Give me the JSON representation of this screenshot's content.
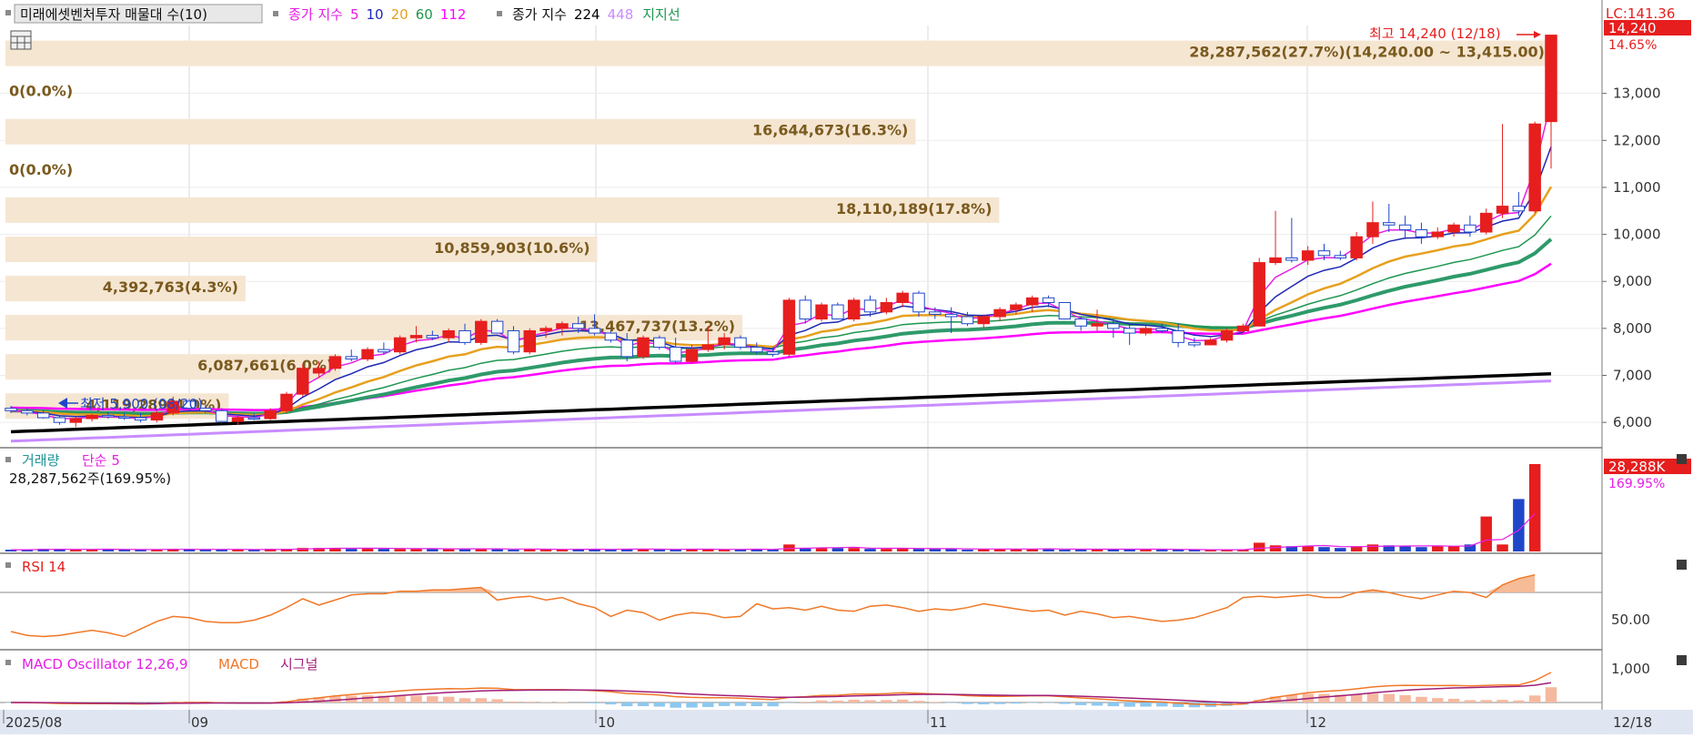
{
  "legend": {
    "panel_title": "미래에셋벤처투자 매물대 수(10)",
    "ma_prefix": "종가 지수",
    "ma_items": [
      {
        "label": "5",
        "color": "#e61ee6"
      },
      {
        "label": "10",
        "color": "#1e28b4"
      },
      {
        "label": "20",
        "color": "#e6a01e"
      },
      {
        "label": "60",
        "color": "#1e9650"
      },
      {
        "label": "112",
        "color": "#ff00ff"
      }
    ],
    "ma2_prefix": "종가 지수",
    "ma2_items": [
      {
        "label": "224",
        "color": "#000000"
      },
      {
        "label": "448",
        "color": "#c88cff"
      }
    ],
    "support_label": "지지선",
    "support_color": "#1e9650"
  },
  "price_panel": {
    "lc_label": "LC:141.36",
    "last_price": "14,240",
    "change_pct": "14.65%",
    "high_label": "최고 14,240 (12/18)",
    "low_label": "최저 5,900 (08/20)",
    "y_ticks": [
      "13,000",
      "12,000",
      "11,000",
      "10,000",
      "9,000",
      "8,000",
      "7,000",
      "6,000"
    ]
  },
  "volume_profile": [
    {
      "label": "28,287,562(27.7%)(14,240.00 ~ 13,415.00)",
      "pct": 27.7
    },
    {
      "label": "0(0.0%)",
      "pct": 0
    },
    {
      "label": "16,644,673(16.3%)",
      "pct": 16.3
    },
    {
      "label": "0(0.0%)",
      "pct": 0
    },
    {
      "label": "18,110,189(17.8%)",
      "pct": 17.8
    },
    {
      "label": "10,859,903(10.6%)",
      "pct": 10.6
    },
    {
      "label": "4,392,763(4.3%)",
      "pct": 4.3
    },
    {
      "label": "13,467,737(13.2%)",
      "pct": 13.2
    },
    {
      "label": "6,087,661(6.0%)",
      "pct": 6.0
    },
    {
      "label": "4,119,289(4.0%)",
      "pct": 4.0
    }
  ],
  "volume_panel": {
    "title": "거래량",
    "ma_label": "단순 5",
    "value_text": "28,287,562주(169.95%)",
    "badge": "28,288K",
    "badge_pct": "169.95%"
  },
  "rsi_panel": {
    "title": "RSI 14",
    "level_label": "50.00"
  },
  "macd_panel": {
    "title": "MACD Oscillator 12,26,9",
    "macd_label": "MACD",
    "signal_label": "시그널",
    "level_label": "1,000"
  },
  "x_axis": {
    "labels": [
      "2025/08",
      "09",
      "10",
      "11",
      "12"
    ],
    "cursor_label": "12/18"
  },
  "colors": {
    "up": "#e61e1e",
    "down": "#1e46c8",
    "rsi": "#f07828",
    "profile_bar": "#f5e6d2",
    "profile_text": "#7a5a1e",
    "macd": "#f07828",
    "signal": "#a01e78",
    "osc_pos": "#f5b9a0",
    "osc_neg": "#8cc8f0"
  },
  "chart_data": {
    "type": "candlestick",
    "x_range": [
      "2025/08",
      "12/18"
    ],
    "ylim": [
      5500,
      14600
    ],
    "candles": [
      [
        6300,
        6350,
        6200,
        6250
      ],
      [
        6250,
        6300,
        6150,
        6200
      ],
      [
        6200,
        6260,
        6080,
        6100
      ],
      [
        6100,
        6150,
        5950,
        6000
      ],
      [
        6000,
        6120,
        5900,
        6080
      ],
      [
        6080,
        6180,
        6020,
        6150
      ],
      [
        6150,
        6220,
        6080,
        6120
      ],
      [
        6120,
        6200,
        6050,
        6100
      ],
      [
        6100,
        6200,
        6000,
        6050
      ],
      [
        6050,
        6250,
        6000,
        6200
      ],
      [
        6200,
        6550,
        6150,
        6450
      ],
      [
        6450,
        6500,
        6250,
        6300
      ],
      [
        6300,
        6380,
        6200,
        6250
      ],
      [
        6250,
        6300,
        5980,
        6020
      ],
      [
        6020,
        6150,
        5950,
        6100
      ],
      [
        6100,
        6180,
        6050,
        6080
      ],
      [
        6080,
        6300,
        6050,
        6250
      ],
      [
        6250,
        6650,
        6200,
        6600
      ],
      [
        6600,
        7250,
        6550,
        7150
      ],
      [
        7050,
        7300,
        6950,
        7150
      ],
      [
        7150,
        7450,
        7100,
        7400
      ],
      [
        7400,
        7550,
        7300,
        7350
      ],
      [
        7350,
        7600,
        7300,
        7550
      ],
      [
        7550,
        7700,
        7450,
        7500
      ],
      [
        7500,
        7850,
        7450,
        7800
      ],
      [
        7800,
        8050,
        7700,
        7850
      ],
      [
        7850,
        7950,
        7750,
        7800
      ],
      [
        7800,
        8000,
        7700,
        7950
      ],
      [
        7950,
        8100,
        7650,
        7700
      ],
      [
        7700,
        8200,
        7650,
        8150
      ],
      [
        8150,
        8200,
        7900,
        7900
      ],
      [
        7950,
        8050,
        7450,
        7500
      ],
      [
        7500,
        8000,
        7450,
        7950
      ],
      [
        7950,
        8050,
        7800,
        8000
      ],
      [
        8000,
        8150,
        7850,
        8100
      ],
      [
        8100,
        8250,
        7900,
        8000
      ],
      [
        8000,
        8300,
        7850,
        7900
      ],
      [
        7900,
        7950,
        7700,
        7750
      ],
      [
        7750,
        7900,
        7300,
        7400
      ],
      [
        7400,
        7850,
        7350,
        7800
      ],
      [
        7800,
        7850,
        7550,
        7600
      ],
      [
        7600,
        7800,
        7250,
        7300
      ],
      [
        7300,
        7650,
        7250,
        7550
      ],
      [
        7550,
        8050,
        7500,
        7650
      ],
      [
        7650,
        7900,
        7550,
        7800
      ],
      [
        7800,
        7850,
        7550,
        7600
      ],
      [
        7600,
        7700,
        7450,
        7500
      ],
      [
        7500,
        7600,
        7400,
        7450
      ],
      [
        7450,
        8650,
        7400,
        8600
      ],
      [
        8600,
        8700,
        8100,
        8200
      ],
      [
        8200,
        8550,
        8150,
        8500
      ],
      [
        8500,
        8550,
        8250,
        8200
      ],
      [
        8200,
        8650,
        8150,
        8600
      ],
      [
        8600,
        8700,
        8250,
        8350
      ],
      [
        8350,
        8650,
        8300,
        8550
      ],
      [
        8550,
        8800,
        8450,
        8750
      ],
      [
        8750,
        8800,
        8250,
        8350
      ],
      [
        8350,
        8450,
        8200,
        8300
      ],
      [
        8300,
        8450,
        7900,
        8250
      ],
      [
        8250,
        8350,
        8050,
        8100
      ],
      [
        8100,
        8300,
        8000,
        8250
      ],
      [
        8250,
        8450,
        8150,
        8400
      ],
      [
        8400,
        8550,
        8300,
        8500
      ],
      [
        8500,
        8700,
        8350,
        8650
      ],
      [
        8650,
        8700,
        8450,
        8550
      ],
      [
        8550,
        8550,
        8250,
        8200
      ],
      [
        8200,
        8250,
        7950,
        8050
      ],
      [
        8050,
        8400,
        7950,
        8100
      ],
      [
        8100,
        8200,
        7800,
        8000
      ],
      [
        8000,
        8100,
        7650,
        7900
      ],
      [
        7900,
        8050,
        7850,
        8000
      ],
      [
        8000,
        8100,
        7900,
        7950
      ],
      [
        7950,
        8100,
        7600,
        7700
      ],
      [
        7700,
        7800,
        7600,
        7650
      ],
      [
        7650,
        7800,
        7650,
        7750
      ],
      [
        7750,
        8000,
        7700,
        7950
      ],
      [
        7950,
        8100,
        7900,
        8050
      ],
      [
        8050,
        9500,
        8050,
        9400
      ],
      [
        9400,
        10500,
        9350,
        9500
      ],
      [
        9500,
        10350,
        9400,
        9450
      ],
      [
        9450,
        9750,
        9350,
        9650
      ],
      [
        9650,
        9800,
        9450,
        9550
      ],
      [
        9550,
        9650,
        9450,
        9500
      ],
      [
        9500,
        10050,
        9450,
        9950
      ],
      [
        9950,
        10700,
        9800,
        10250
      ],
      [
        10250,
        10650,
        10050,
        10200
      ],
      [
        10200,
        10400,
        9900,
        10100
      ],
      [
        10100,
        10250,
        9800,
        9950
      ],
      [
        9950,
        10150,
        9900,
        10050
      ],
      [
        10050,
        10250,
        9950,
        10200
      ],
      [
        10200,
        10400,
        9950,
        10050
      ],
      [
        10050,
        10550,
        10000,
        10450
      ],
      [
        10450,
        12350,
        10350,
        10600
      ],
      [
        10600,
        10900,
        10400,
        10500
      ],
      [
        10500,
        12400,
        10450,
        12350
      ],
      [
        12400,
        13100,
        11400,
        14240
      ]
    ],
    "volume_pct": [
      2,
      2,
      3,
      3,
      2,
      2,
      3,
      2,
      2,
      2,
      3,
      3,
      2,
      2,
      2,
      2,
      3,
      3,
      4,
      4,
      4,
      3,
      4,
      3,
      3,
      3,
      3,
      3,
      3,
      3,
      3,
      2,
      3,
      2,
      2,
      3,
      3,
      2,
      3,
      3,
      2,
      2,
      3,
      3,
      2,
      2,
      3,
      2,
      8,
      4,
      4,
      4,
      4,
      3,
      3,
      4,
      3,
      3,
      3,
      2,
      3,
      3,
      3,
      3,
      3,
      2,
      2,
      3,
      3,
      3,
      2,
      2,
      2,
      2,
      2,
      2,
      2,
      10,
      7,
      6,
      6,
      5,
      4,
      6,
      8,
      7,
      6,
      5,
      6,
      6,
      8,
      40,
      8,
      60,
      100
    ],
    "rsi": [
      33,
      30,
      29,
      30,
      32,
      34,
      32,
      29,
      35,
      41,
      45,
      44,
      41,
      40,
      40,
      42,
      46,
      52,
      59,
      54,
      58,
      62,
      63,
      63,
      65,
      65,
      66,
      66,
      67,
      68,
      58,
      60,
      61,
      58,
      60,
      55,
      52,
      45,
      50,
      48,
      42,
      46,
      48,
      47,
      44,
      45,
      55,
      51,
      52,
      50,
      53,
      50,
      49,
      53,
      54,
      52,
      49,
      51,
      50,
      52,
      55,
      53,
      51,
      49,
      50,
      46,
      49,
      47,
      44,
      45,
      43,
      41,
      42,
      44,
      48,
      52,
      60,
      61,
      60,
      61,
      62,
      60,
      60,
      64,
      66,
      64,
      61,
      59,
      62,
      65,
      64,
      60,
      70,
      75,
      78
    ],
    "y_ticks": [
      "13,000",
      "12,000",
      "11,000",
      "10,000",
      "9,000",
      "8,000",
      "7,000",
      "6,000"
    ]
  }
}
